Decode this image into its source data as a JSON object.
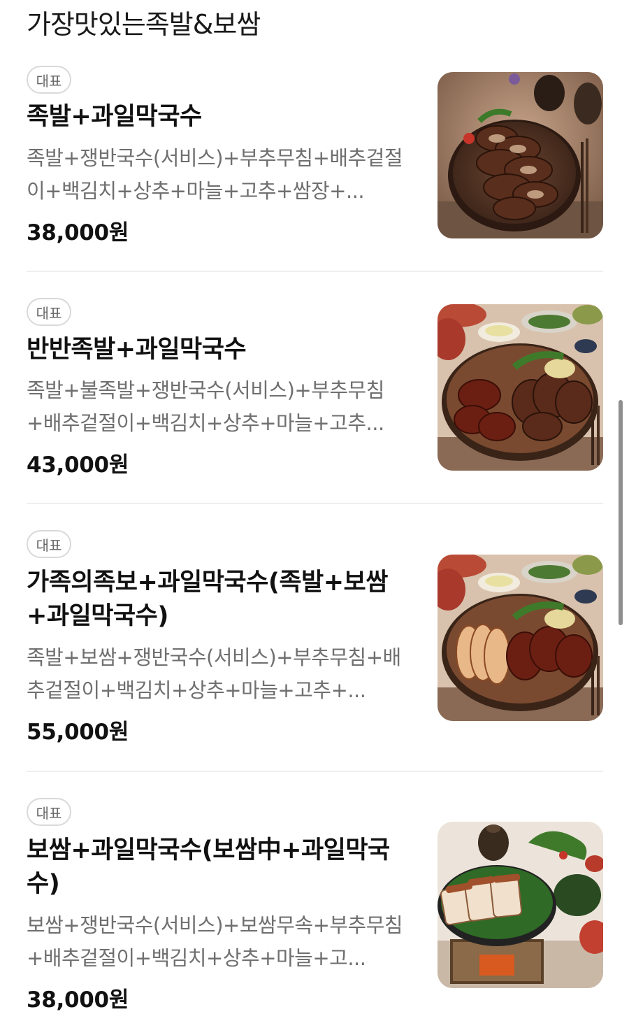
{
  "section": {
    "title": "가장맛있는족발&보쌈"
  },
  "items": [
    {
      "badge": "대표",
      "name": "족발+과일막국수",
      "description": "족발+쟁반국수(서비스)+부추무침+배추겉절이+백김치+상추+마늘+고추+쌈장+...",
      "price": "38,000원",
      "image_icon": "jokbal-platter-photo"
    },
    {
      "badge": "대표",
      "name": "반반족발+과일막국수",
      "description": "족발+불족발+쟁반국수(서비스)+부추무침+배추겉절이+백김치+상추+마늘+고추...",
      "price": "43,000원",
      "image_icon": "half-half-jokbal-photo"
    },
    {
      "badge": "대표",
      "name": "가족의족보+과일막국수(족발+보쌈+과일막국수)",
      "description": "족발+보쌈+쟁반국수(서비스)+부추무침+배추겉절이+백김치+상추+마늘+고추+...",
      "price": "55,000원",
      "image_icon": "jokbal-bossam-combo-photo"
    },
    {
      "badge": "대표",
      "name": "보쌈+과일막국수(보쌈中+과일막국수)",
      "description": "보쌈+쟁반국수(서비스)+보쌈무속+부추무침+배추겉절이+백김치+상추+마늘+고...",
      "price": "38,000원",
      "image_icon": "bossam-platter-photo"
    }
  ],
  "colors": {
    "text_primary": "#111111",
    "text_secondary": "#6f6f6f",
    "badge_border": "#d9d9d9",
    "divider": "#efefef"
  }
}
